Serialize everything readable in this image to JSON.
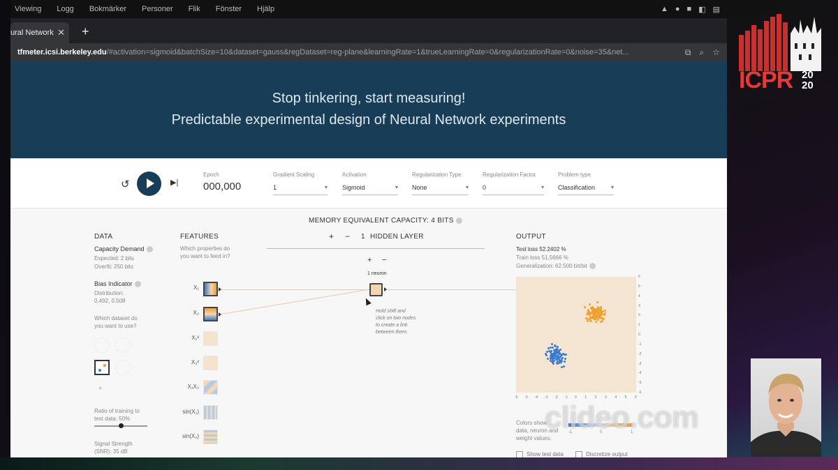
{
  "os_menu": [
    "Viewing",
    "Logg",
    "Bokmärker",
    "Personer",
    "Flik",
    "Fönster",
    "Hjälp"
  ],
  "browser": {
    "tab_title": "ural Network",
    "tab_close": "✕",
    "new_tab": "+",
    "url_host": "tfmeter.icsi.berkeley.edu",
    "url_rest": "/#activation=sigmoid&batchSize=10&dataset=gauss&regDataset=reg-plane&learningRate=1&trueLearningRate=0&regularizationRate=0&noise=35&net..."
  },
  "hero": {
    "line1": "Stop tinkering, start measuring!",
    "line2": "Predictable experimental design of Neural Network experiments"
  },
  "controls": {
    "epoch_label": "Epoch",
    "epoch_value": "000,000",
    "gradient_label": "Gradient Scaling",
    "gradient_value": "1",
    "activation_label": "Activation",
    "activation_value": "Sigmoid",
    "reg_type_label": "Regularization Type",
    "reg_type_value": "None",
    "reg_factor_label": "Regularization Factor",
    "reg_factor_value": "0",
    "problem_label": "Problem type",
    "problem_value": "Classification"
  },
  "mec": {
    "title": "MEMORY EQUIVALENT CAPACITY: 4 BITS"
  },
  "data_panel": {
    "heading": "DATA",
    "capacity_title": "Capacity Demand",
    "expected": "Expected: 2 bits",
    "overfit": "Overfit: 250 bits",
    "bias_title": "Bias Indicator",
    "distribution_label": "Distribution:",
    "distribution_value": "0.492, 0.508",
    "dataset_q1": "Which dataset do",
    "dataset_q2": "you want to use?",
    "ratio1": "Ratio of training to",
    "ratio2": "test data:  50%",
    "ratio_fraction": 0.5,
    "signal1": "Signal Strength",
    "signal2": "(SNR):  35 dB"
  },
  "features_panel": {
    "heading": "FEATURES",
    "question1": "Which properties do",
    "question2": "you want to feed in?",
    "labels": [
      "X₁",
      "X₂",
      "X₁²",
      "X₂²",
      "X₁X₂",
      "sin(X₁)",
      "sin(X₂)"
    ]
  },
  "hidden": {
    "plus": "+",
    "minus": "−",
    "count": "1",
    "label": "HIDDEN LAYER",
    "neuron_label": "1 neuron",
    "hint1": "Hold shift and",
    "hint2": "click on two nodes",
    "hint3": "to create a link",
    "hint4": "between them."
  },
  "output": {
    "heading": "OUTPUT",
    "test_loss": "Test loss 52.2402 %",
    "train_loss": "Train loss 51.5666 %",
    "generalization": "Generalization: 62.500 bit/bit",
    "colors_text1": "Colors show",
    "colors_text2": "data, neuron and",
    "colors_text3": "weight values.",
    "scale_min": "-1",
    "scale_mid": "0",
    "scale_max": "1",
    "show_test": "Show test data",
    "discretize": "Discretize output",
    "y_ticks": [
      "6",
      "5",
      "4",
      "3",
      "2",
      "1",
      "0",
      "-1",
      "-2",
      "-3",
      "-4",
      "-5",
      "-6"
    ],
    "x_ticks": [
      "-6",
      "-5",
      "-4",
      "-3",
      "-2",
      "-1",
      "0",
      "1",
      "2",
      "3",
      "4",
      "5",
      "6"
    ]
  },
  "colors": {
    "hero_bg": "#183d56",
    "blue": "#3a7ccf",
    "orange": "#f0a030",
    "plot_bg": "#f4e5d2",
    "logo_red": "#e23a3a"
  },
  "watermark": "clideo.com",
  "logo": {
    "text": "ICPR",
    "year_top": "20",
    "year_bottom": "20"
  }
}
